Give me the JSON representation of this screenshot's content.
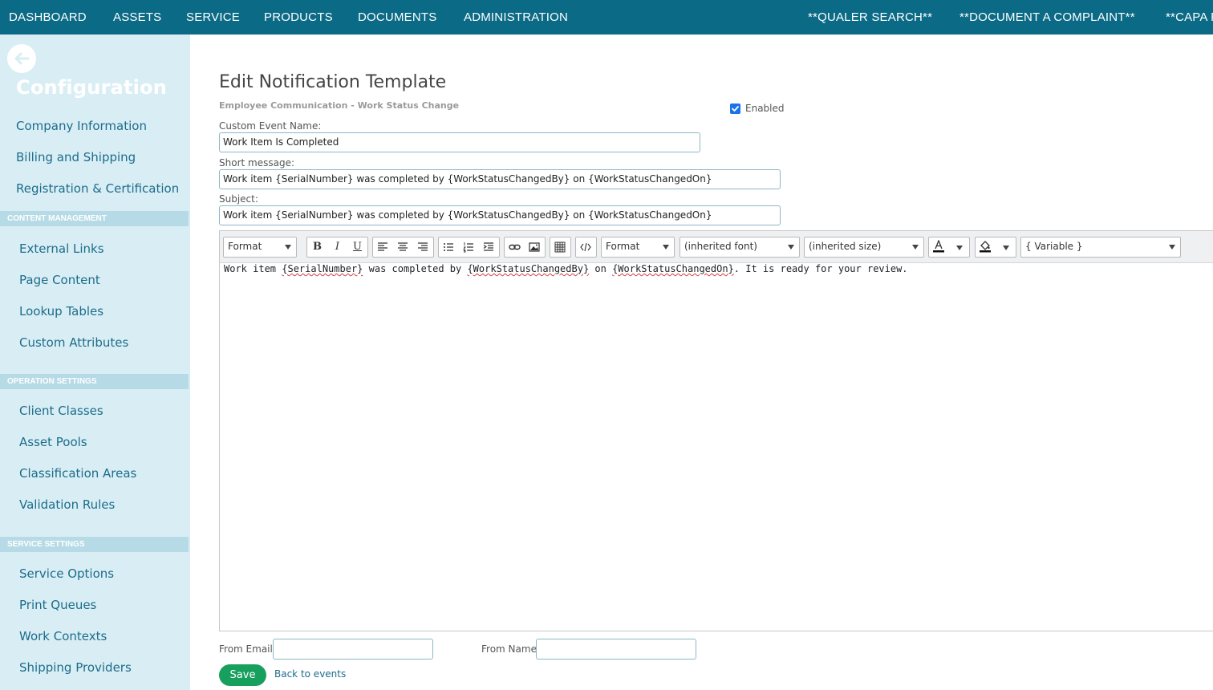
{
  "topnav": {
    "items": [
      "DASHBOARD",
      "ASSETS",
      "SERVICE",
      "PRODUCTS",
      "DOCUMENTS",
      "ADMINISTRATION",
      "**QUALER SEARCH**",
      "**DOCUMENT A COMPLAINT**",
      "**CAPA R"
    ]
  },
  "sidebar": {
    "back_icon": "arrow-left-icon",
    "title": "Configuration",
    "top_links": [
      "Company Information",
      "Billing and Shipping",
      "Registration & Certification"
    ],
    "sections": [
      {
        "heading": "CONTENT MANAGEMENT",
        "links": [
          "External Links",
          "Page Content",
          "Lookup Tables",
          "Custom Attributes"
        ]
      },
      {
        "heading": "OPERATION SETTINGS",
        "links": [
          "Client Classes",
          "Asset Pools",
          "Classification Areas",
          "Validation Rules"
        ]
      },
      {
        "heading": "SERVICE SETTINGS",
        "links": [
          "Service Options",
          "Print Queues",
          "Work Contexts",
          "Shipping Providers"
        ]
      }
    ]
  },
  "main": {
    "title": "Edit Notification Template",
    "subtitle": "Employee Communication - Work Status Change",
    "enabled_label": "Enabled",
    "enabled": true,
    "custom_event_label": "Custom Event Name:",
    "custom_event_value": "Work Item Is Completed",
    "short_message_label": "Short message:",
    "short_message_value": "Work item {SerialNumber} was completed by {WorkStatusChangedBy} on {WorkStatusChangedOn}",
    "subject_label": "Subject:",
    "subject_value": "Work item {SerialNumber} was completed by {WorkStatusChangedBy} on {WorkStatusChangedOn}"
  },
  "editor": {
    "format_select_1": "Format",
    "format_select_2": "Format",
    "font_select": "(inherited font)",
    "size_select": "(inherited size)",
    "variable_select": "{ Variable }",
    "bold": "B",
    "italic": "I",
    "underline": "U",
    "body": {
      "t1": "Work item ",
      "v1": "{SerialNumber}",
      "t2": " was completed by ",
      "v2": "{WorkStatusChangedBy}",
      "t3": " on ",
      "v3": "{WorkStatusChangedOn}",
      "t4": ". It is ready for your review."
    }
  },
  "footer": {
    "from_email_label": "From Email:",
    "from_email_value": "",
    "from_name_label": "From Name:",
    "from_name_value": "",
    "save_label": "Save",
    "back_label": "Back to events"
  },
  "colors": {
    "topnav_bg": "#0b6a86",
    "sidebar_bg": "#d9eef4",
    "link": "#1c6c8b",
    "save_green": "#17a05d"
  }
}
